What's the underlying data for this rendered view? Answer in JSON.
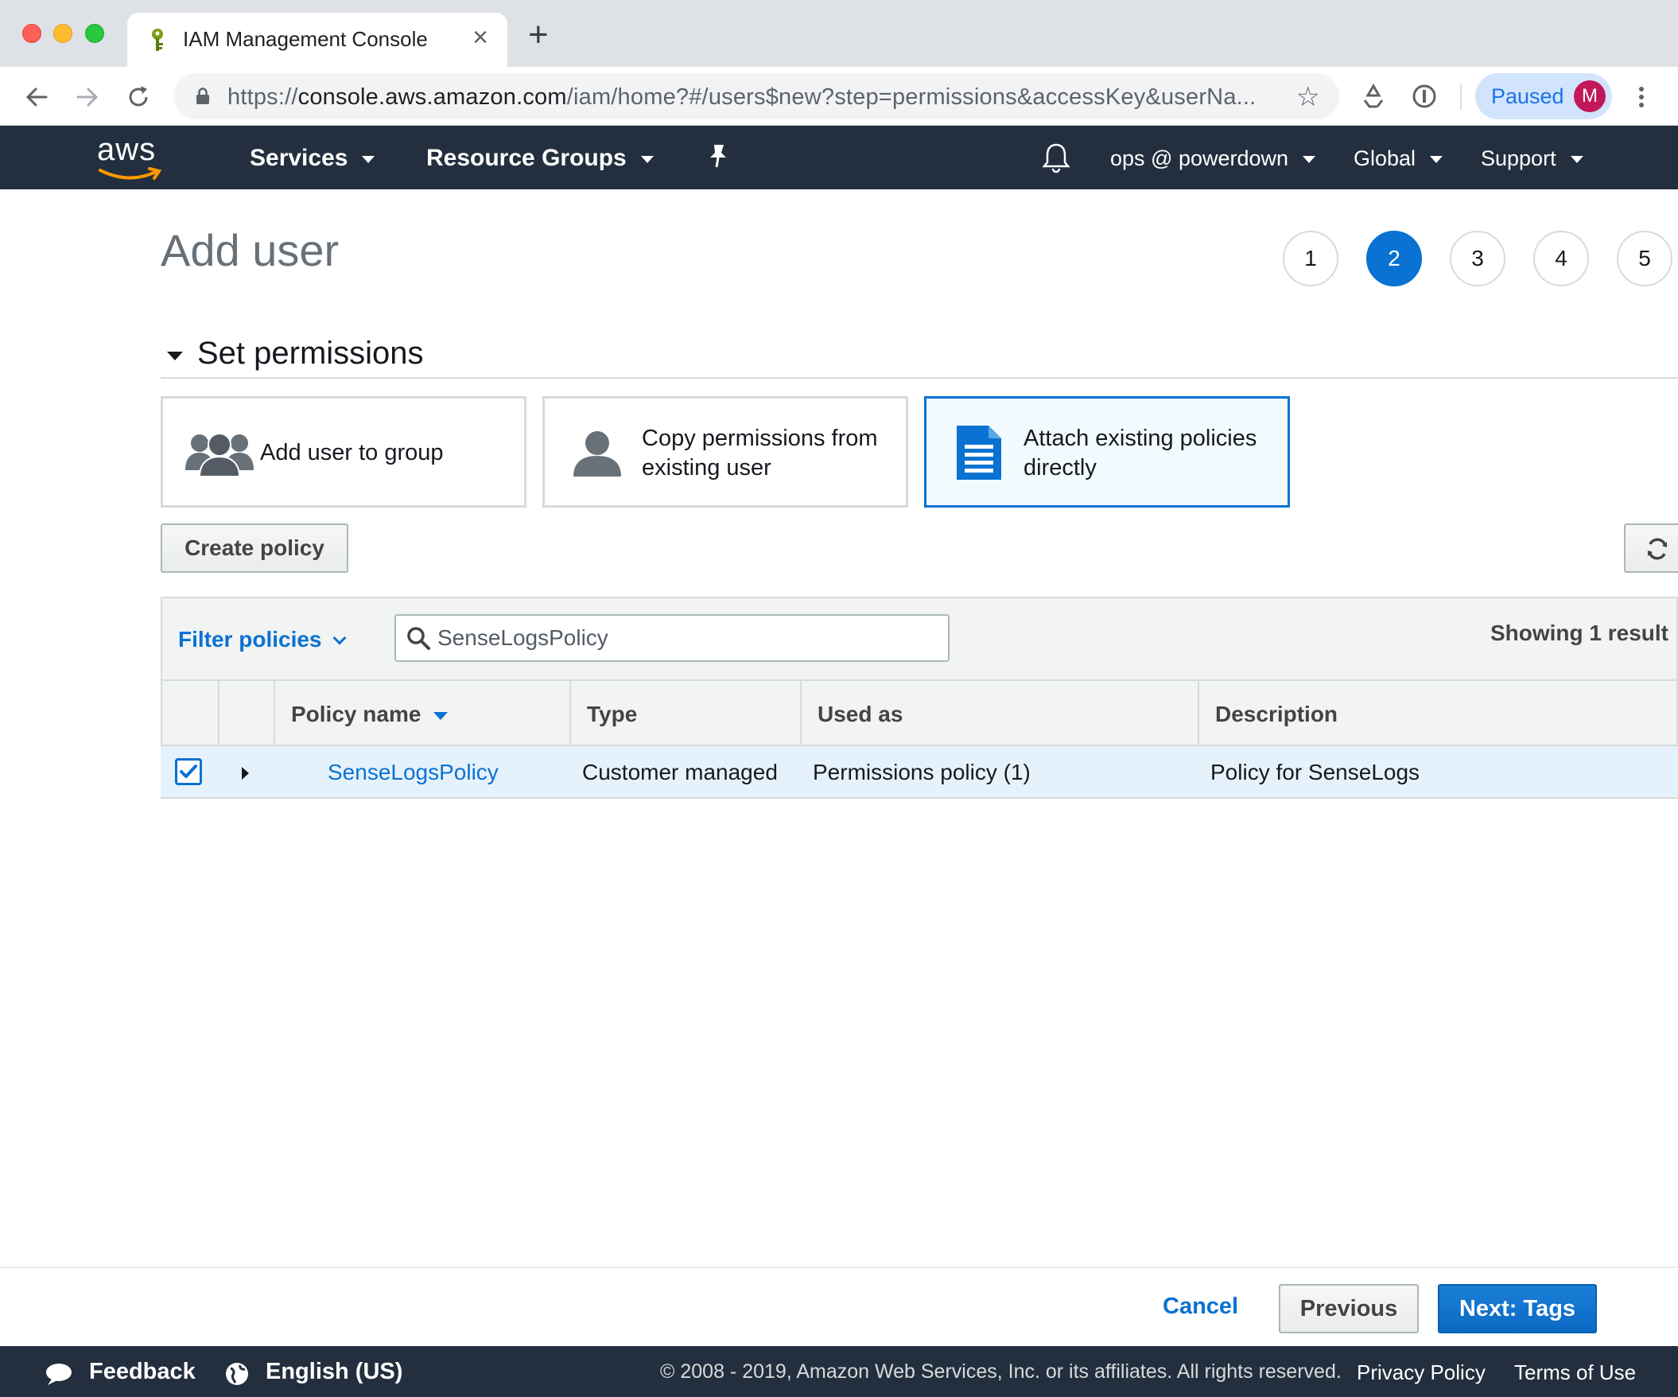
{
  "browser": {
    "tab_title": "IAM Management Console",
    "url_scheme": "https://",
    "url_host": "console.aws.amazon.com",
    "url_path": "/iam/home?#/users$new?step=permissions&accessKey&userNa...",
    "profile_status": "Paused",
    "profile_initial": "M"
  },
  "aws_nav": {
    "logo": "aws",
    "services": "Services",
    "resource_groups": "Resource Groups",
    "account": "ops @ powerdown",
    "region": "Global",
    "support": "Support"
  },
  "page": {
    "title": "Add user",
    "steps": [
      "1",
      "2",
      "3",
      "4",
      "5"
    ],
    "active_step": "2",
    "section_title": "Set permissions"
  },
  "options": {
    "add_to_group": "Add user to group",
    "copy_line1": "Copy permissions from",
    "copy_line2": "existing user",
    "attach_line1": "Attach existing policies",
    "attach_line2": "directly"
  },
  "actions": {
    "create_policy": "Create policy"
  },
  "filter": {
    "label": "Filter policies",
    "search_value": "SenseLogsPolicy",
    "result_count": "Showing 1 result"
  },
  "table": {
    "headers": {
      "policy_name": "Policy name",
      "type": "Type",
      "used_as": "Used as",
      "description": "Description"
    },
    "rows": [
      {
        "checked": true,
        "policy_name": "SenseLogsPolicy",
        "type": "Customer managed",
        "used_as": "Permissions policy (1)",
        "description": "Policy for SenseLogs"
      }
    ]
  },
  "wizard_buttons": {
    "cancel": "Cancel",
    "previous": "Previous",
    "next": "Next: Tags"
  },
  "footer": {
    "feedback": "Feedback",
    "language": "English (US)",
    "copyright": "© 2008 - 2019, Amazon Web Services, Inc. or its affiliates. All rights reserved.",
    "privacy": "Privacy Policy",
    "terms": "Terms of Use"
  },
  "colors": {
    "aws_nav_bg": "#232f3e",
    "accent_blue": "#0972d3",
    "aws_orange": "#ff9900"
  }
}
